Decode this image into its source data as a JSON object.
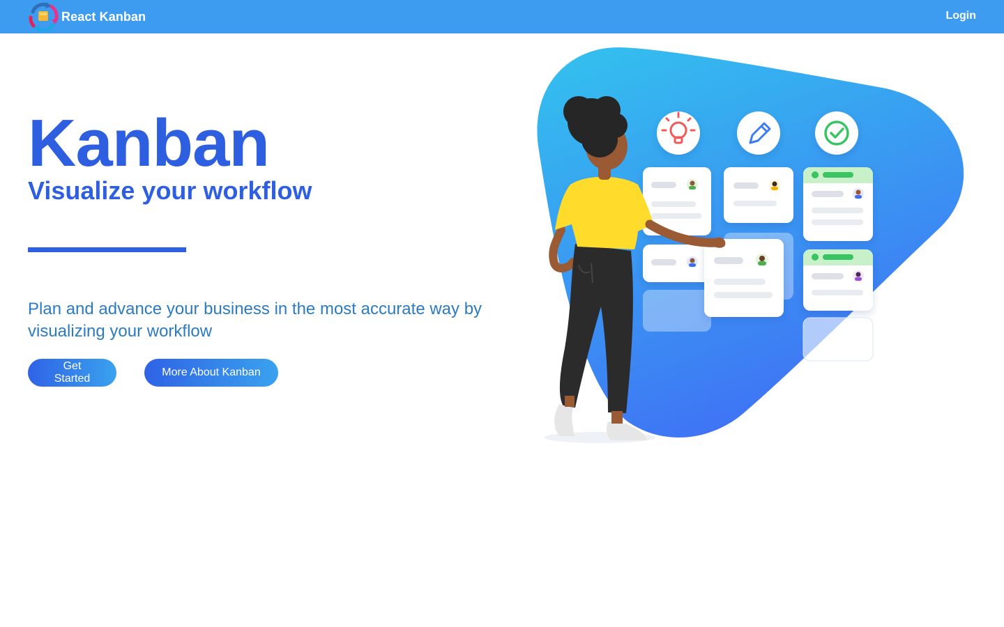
{
  "navbar": {
    "brand": "React Kanban",
    "login": "Login"
  },
  "hero": {
    "title": "Kanban",
    "subtitle": "Visualize your workflow",
    "description": "Plan and advance your business in the most accurate way by visualizing your workflow",
    "get_started": "Get Started",
    "more_about": "More About Kanban"
  },
  "colors": {
    "navbar": "#3d9cf0",
    "primary": "#2d5fe0",
    "description": "#2b7bc4",
    "blob_top": "#33c2ee",
    "blob_bottom": "#3f74f5",
    "shirt": "#ffdb2c"
  },
  "icons": {
    "brand_logo": "kanban-cycle-logo",
    "column_1": "lightbulb-icon",
    "column_2": "pencil-icon",
    "column_3": "check-circle-icon"
  }
}
